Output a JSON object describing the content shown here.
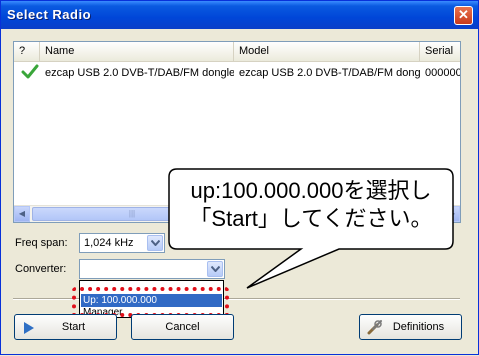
{
  "window": {
    "title": "Select Radio",
    "close_glyph": "✕"
  },
  "table": {
    "columns": [
      "?",
      "Name",
      "Model",
      "Serial"
    ],
    "rows": [
      {
        "checked": true,
        "name": "ezcap USB 2.0 DVB-T/DAB/FM dongle",
        "model": "ezcap USB 2.0 DVB-T/DAB/FM dongle",
        "serial": "000000"
      }
    ],
    "scroll_left": "◀",
    "scroll_right": "▶",
    "scroll_grip": "|||"
  },
  "freq_span": {
    "label": "Freq span:",
    "value": "1,024 kHz"
  },
  "converter": {
    "label": "Converter:",
    "value": "",
    "options": [
      "Up: 100.000.000",
      "Manager"
    ],
    "selected_index": 0
  },
  "buttons": {
    "start": "Start",
    "cancel": "Cancel",
    "definitions": "Definitions"
  },
  "callout": {
    "line1": "up:100.000.000を選択し",
    "line2": "「Start」してください。"
  },
  "colors": {
    "titlebar": "#0046d8",
    "selection": "#316ac5",
    "highlight_ring": "#e0101a"
  },
  "icons": [
    "close-icon",
    "checkmark-icon",
    "dropdown-arrow-icon",
    "play-icon",
    "wrench-screwdriver-icon"
  ]
}
